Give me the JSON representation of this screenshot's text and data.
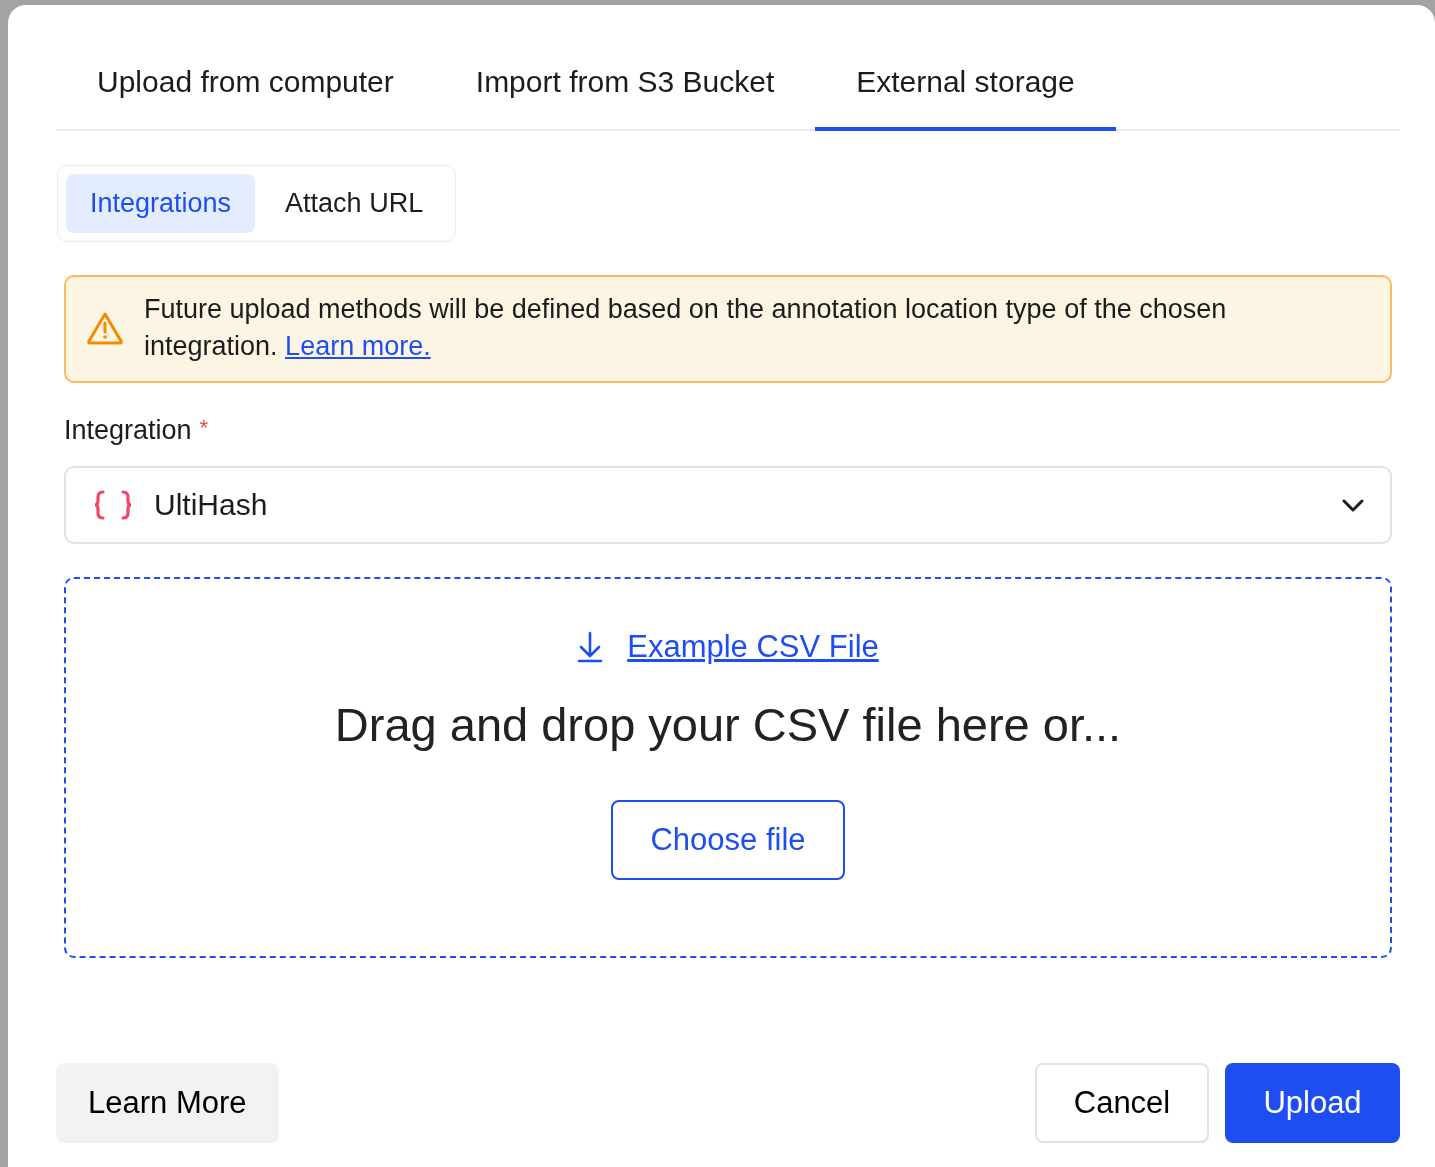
{
  "tabs": [
    {
      "label": "Upload from computer",
      "selected": false
    },
    {
      "label": "Import from S3 Bucket",
      "selected": false
    },
    {
      "label": "External storage",
      "selected": true
    }
  ],
  "subtabs": [
    {
      "label": "Integrations",
      "selected": true
    },
    {
      "label": "Attach URL",
      "selected": false
    }
  ],
  "alert": {
    "text": "Future upload methods will be defined based on the annotation location type of the chosen integration.",
    "link": "Learn more."
  },
  "integration": {
    "label": "Integration",
    "required_mark": "*",
    "value": "UltiHash"
  },
  "dropzone": {
    "example_link": "Example CSV File",
    "text": "Drag and drop your CSV file here or...",
    "button": "Choose file"
  },
  "footer": {
    "learn_more": "Learn More",
    "cancel": "Cancel",
    "upload": "Upload"
  }
}
